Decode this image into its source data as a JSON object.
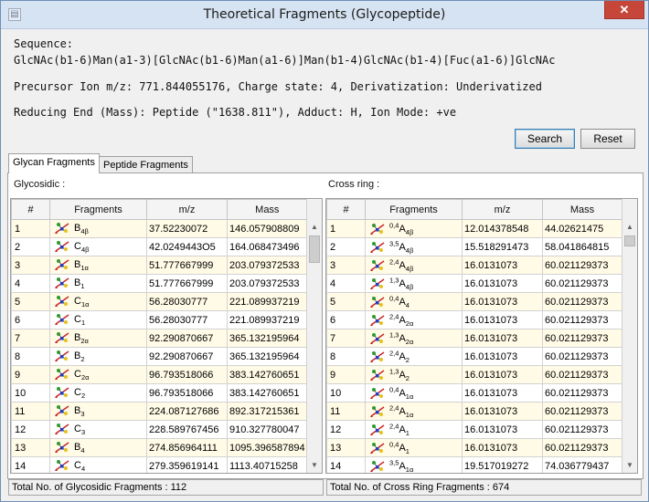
{
  "window": {
    "title": "Theoretical Fragments (Glycopeptide)",
    "close_glyph": "✕"
  },
  "info": {
    "sequence_label": "Sequence:",
    "sequence": "GlcNAc(b1-6)Man(a1-3)[GlcNAc(b1-6)Man(a1-6)]Man(b1-4)GlcNAc(b1-4)[Fuc(a1-6)]GlcNAc",
    "precursor_line": "Precursor Ion m/z: 771.844055176, Charge state: 4, Derivatization: Underivatized",
    "reducing_line": "Reducing End (Mass): Peptide (\"1638.811\"), Adduct: H, Ion Mode: +ve"
  },
  "buttons": {
    "search": "Search",
    "reset": "Reset"
  },
  "tabs": [
    {
      "label": "Glycan Fragments",
      "active": true
    },
    {
      "label": "Peptide Fragments",
      "active": false
    }
  ],
  "glycosidic": {
    "label": "Glycosidic :",
    "headers": [
      "#",
      "Fragments",
      "m/z",
      "Mass"
    ],
    "rows": [
      {
        "n": "1",
        "pre": "",
        "letter": "B",
        "sub": "4β",
        "mz": "37.52230072",
        "mass": "146.057908809"
      },
      {
        "n": "2",
        "pre": "",
        "letter": "C",
        "sub": "4β",
        "mz": "42.0249443O5",
        "mass": "164.068473496"
      },
      {
        "n": "3",
        "pre": "",
        "letter": "B",
        "sub": "1α",
        "mz": "51.777667999",
        "mass": "203.079372533"
      },
      {
        "n": "4",
        "pre": "",
        "letter": "B",
        "sub": "1",
        "mz": "51.777667999",
        "mass": "203.079372533"
      },
      {
        "n": "5",
        "pre": "",
        "letter": "C",
        "sub": "1α",
        "mz": "56.28030777",
        "mass": "221.089937219"
      },
      {
        "n": "6",
        "pre": "",
        "letter": "C",
        "sub": "1",
        "mz": "56.28030777",
        "mass": "221.089937219"
      },
      {
        "n": "7",
        "pre": "",
        "letter": "B",
        "sub": "2α",
        "mz": "92.290870667",
        "mass": "365.132195964"
      },
      {
        "n": "8",
        "pre": "",
        "letter": "B",
        "sub": "2",
        "mz": "92.290870667",
        "mass": "365.132195964"
      },
      {
        "n": "9",
        "pre": "",
        "letter": "C",
        "sub": "2α",
        "mz": "96.793518066",
        "mass": "383.142760651"
      },
      {
        "n": "10",
        "pre": "",
        "letter": "C",
        "sub": "2",
        "mz": "96.793518066",
        "mass": "383.142760651"
      },
      {
        "n": "11",
        "pre": "",
        "letter": "B",
        "sub": "3",
        "mz": "224.087127686",
        "mass": "892.317215361"
      },
      {
        "n": "12",
        "pre": "",
        "letter": "C",
        "sub": "3",
        "mz": "228.589767456",
        "mass": "910.327780047"
      },
      {
        "n": "13",
        "pre": "",
        "letter": "B",
        "sub": "4",
        "mz": "274.856964111",
        "mass": "1095.396587894"
      },
      {
        "n": "14",
        "pre": "",
        "letter": "C",
        "sub": "4",
        "mz": "279.359619141",
        "mass": "1113.40715258"
      }
    ],
    "total": "Total No. of Glycosidic Fragments : 112"
  },
  "crossring": {
    "label": "Cross ring :",
    "headers": [
      "#",
      "Fragments",
      "m/z",
      "Mass"
    ],
    "rows": [
      {
        "n": "1",
        "pre": "0,4",
        "letter": "A",
        "sub": "4β",
        "mz": "12.014378548",
        "mass": "44.02621475"
      },
      {
        "n": "2",
        "pre": "3,5",
        "letter": "A",
        "sub": "4β",
        "mz": "15.518291473",
        "mass": "58.041864815"
      },
      {
        "n": "3",
        "pre": "2,4",
        "letter": "A",
        "sub": "4β",
        "mz": "16.0131073",
        "mass": "60.021129373"
      },
      {
        "n": "4",
        "pre": "1,3",
        "letter": "A",
        "sub": "4β",
        "mz": "16.0131073",
        "mass": "60.021129373"
      },
      {
        "n": "5",
        "pre": "0,4",
        "letter": "A",
        "sub": "4",
        "mz": "16.0131073",
        "mass": "60.021129373"
      },
      {
        "n": "6",
        "pre": "2,4",
        "letter": "A",
        "sub": "2α",
        "mz": "16.0131073",
        "mass": "60.021129373"
      },
      {
        "n": "7",
        "pre": "1,3",
        "letter": "A",
        "sub": "2α",
        "mz": "16.0131073",
        "mass": "60.021129373"
      },
      {
        "n": "8",
        "pre": "2,4",
        "letter": "A",
        "sub": "2",
        "mz": "16.0131073",
        "mass": "60.021129373"
      },
      {
        "n": "9",
        "pre": "1,3",
        "letter": "A",
        "sub": "2",
        "mz": "16.0131073",
        "mass": "60.021129373"
      },
      {
        "n": "10",
        "pre": "0,4",
        "letter": "A",
        "sub": "1α",
        "mz": "16.0131073",
        "mass": "60.021129373"
      },
      {
        "n": "11",
        "pre": "2,4",
        "letter": "A",
        "sub": "1α",
        "mz": "16.0131073",
        "mass": "60.021129373"
      },
      {
        "n": "12",
        "pre": "2,4",
        "letter": "A",
        "sub": "1",
        "mz": "16.0131073",
        "mass": "60.021129373"
      },
      {
        "n": "13",
        "pre": "0,4",
        "letter": "A",
        "sub": "1",
        "mz": "16.0131073",
        "mass": "60.021129373"
      },
      {
        "n": "14",
        "pre": "3,5",
        "letter": "A",
        "sub": "1α",
        "mz": "19.517019272",
        "mass": "74.036779437"
      }
    ],
    "total": "Total No. of Cross Ring Fragments : 674"
  },
  "icons": {
    "fragment": "glycan-structure-icon",
    "scroll_up": "▲",
    "scroll_down": "▼"
  },
  "colors": {
    "odd_row": "#fffbe6",
    "icon_green": "#2e9a2e",
    "icon_red": "#cc2222",
    "icon_blue": "#1f3fbf",
    "icon_yellow": "#e6c21a"
  }
}
